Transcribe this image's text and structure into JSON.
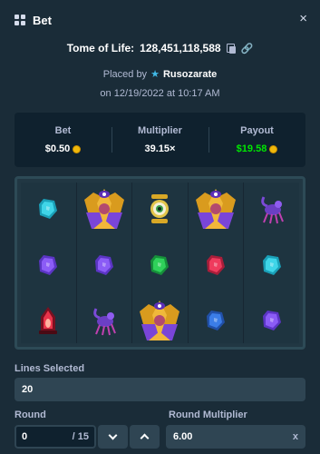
{
  "header": {
    "title": "Bet",
    "close_glyph": "×"
  },
  "bet": {
    "game": "Tome of Life:",
    "id": "128,451,118,588",
    "placed_by_label": "Placed by",
    "user": "Rusozarate",
    "date_prefix": "on",
    "date": "12/19/2022 at 10:17 AM"
  },
  "stats": {
    "bet_label": "Bet",
    "bet_value": "$0.50",
    "multiplier_label": "Multiplier",
    "multiplier_value": "39.15×",
    "payout_label": "Payout",
    "payout_value": "$19.58"
  },
  "reels": [
    [
      "cyan-gem-symbol",
      "purple-gem-symbol",
      "red-lantern-symbol"
    ],
    [
      "eye-priestess-symbol",
      "purple-gem-symbol",
      "scorpion-symbol"
    ],
    [
      "eye-idol-symbol",
      "green-gem-symbol",
      "eye-priestess-symbol"
    ],
    [
      "eye-priestess-symbol",
      "red-gem-symbol",
      "blue-gem-symbol"
    ],
    [
      "scorpion-symbol",
      "cyan-gem-symbol",
      "purple-gem-symbol"
    ]
  ],
  "controls": {
    "lines_label": "Lines Selected",
    "lines_value": "20",
    "round_label": "Round",
    "round_value": "0",
    "round_total": "/ 15",
    "round_mult_label": "Round Multiplier",
    "round_mult_value": "6.00",
    "round_mult_suffix": "x"
  },
  "colors": {
    "background": "#1a2c38",
    "panel": "#0f212e",
    "field": "#2f4553",
    "payout_green": "#00e701",
    "muted_text": "#b1bad3"
  }
}
